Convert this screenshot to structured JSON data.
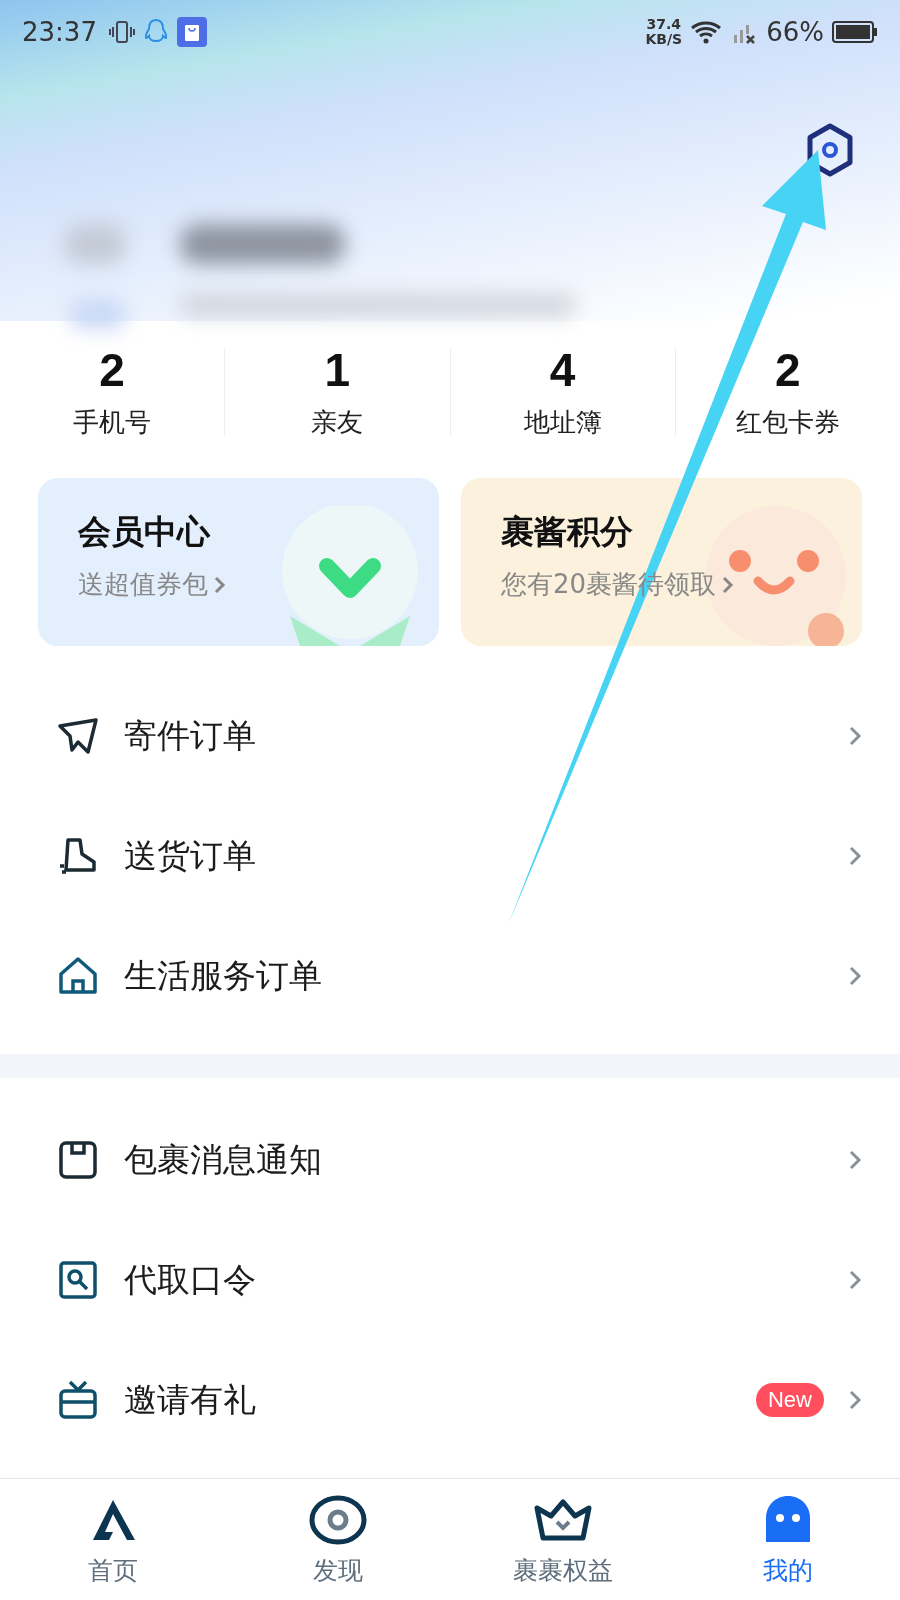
{
  "status_bar": {
    "time": "23:37",
    "net_speed": "37.4",
    "net_unit": "KB/S",
    "battery": "66%"
  },
  "stats": [
    {
      "value": "2",
      "label": "手机号"
    },
    {
      "value": "1",
      "label": "亲友"
    },
    {
      "value": "4",
      "label": "地址簿"
    },
    {
      "value": "2",
      "label": "红包卡券"
    }
  ],
  "cards": [
    {
      "kind": "member",
      "title": "会员中心",
      "subtitle": "送超值券包"
    },
    {
      "kind": "points",
      "title": "裹酱积分",
      "subtitle": "您有20裹酱待领取"
    }
  ],
  "menu_sections": [
    {
      "items": [
        {
          "label": "寄件订单"
        },
        {
          "label": "送货订单"
        },
        {
          "label": "生活服务订单"
        }
      ]
    },
    {
      "items": [
        {
          "label": "包裹消息通知"
        },
        {
          "label": "代取口令"
        },
        {
          "label": "邀请有礼",
          "badge": "New"
        }
      ]
    }
  ],
  "tab_bar": [
    {
      "label": "首页",
      "selected": false
    },
    {
      "label": "发现",
      "selected": false
    },
    {
      "label": "裹裹权益",
      "selected": false
    },
    {
      "label": "我的",
      "selected": true
    }
  ]
}
